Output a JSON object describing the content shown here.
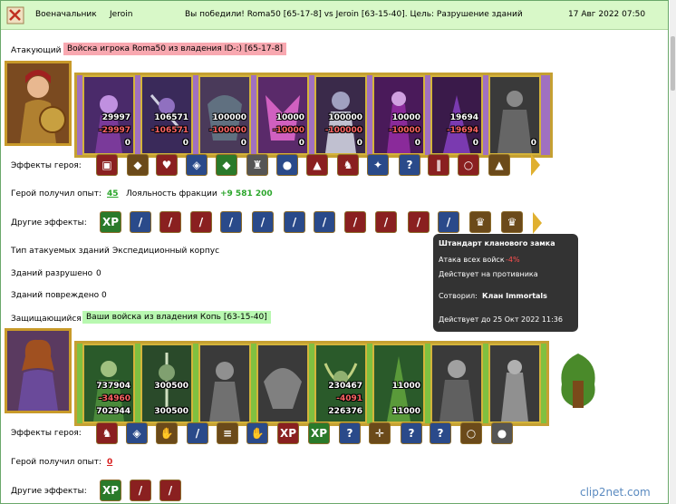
{
  "header": {
    "rank": "Военачальник",
    "player": "Jeroin",
    "result": "Вы победили! Roma50 [65-17-8] vs Jeroin [63-15-40]. Цель: Разрушение зданий",
    "datetime": "17 Авг 2022 07:50"
  },
  "attacker": {
    "label": "Атакующий",
    "name": "Войска игрока Roma50 из владения ID-:) [65-17-8]",
    "units": [
      {
        "top": "29997",
        "loss": "-29997",
        "bottom": "0"
      },
      {
        "top": "106571",
        "loss": "-106571",
        "bottom": "0"
      },
      {
        "top": "100000",
        "loss": "-100000",
        "bottom": "0"
      },
      {
        "top": "10000",
        "loss": "-10000",
        "bottom": "0"
      },
      {
        "top": "100000",
        "loss": "-100000",
        "bottom": "0"
      },
      {
        "top": "10000",
        "loss": "-10000",
        "bottom": "0"
      },
      {
        "top": "19694",
        "loss": "-19694",
        "bottom": "0"
      },
      {
        "top": "",
        "loss": "",
        "bottom": "0"
      }
    ],
    "hero_effects_label": "Эффекты героя:",
    "exp_label": "Герой получил опыт:",
    "exp_value": "45",
    "loyalty_label": "Лояльность фракции",
    "loyalty_value": "+9 581 200",
    "other_effects_label": "Другие эффекты:",
    "target_label": "Тип атакуемых зданий",
    "target_value": "Экспедиционный корпус",
    "destroyed_label": "Зданий разрушено",
    "destroyed_value": "0",
    "damaged_label": "Зданий повреждено",
    "damaged_value": "0"
  },
  "defender": {
    "label": "Защищающийся",
    "name": "Ваши войска из владения Копь [63-15-40]",
    "units": [
      {
        "top": "737904",
        "loss": "-34960",
        "bottom": "702944"
      },
      {
        "top": "300500",
        "loss": "",
        "bottom": "300500"
      },
      {
        "top": "",
        "loss": "",
        "bottom": ""
      },
      {
        "top": "",
        "loss": "",
        "bottom": ""
      },
      {
        "top": "230467",
        "loss": "-4091",
        "bottom": "226376"
      },
      {
        "top": "11000",
        "loss": "",
        "bottom": "11000"
      },
      {
        "top": "",
        "loss": "",
        "bottom": ""
      },
      {
        "top": "",
        "loss": "",
        "bottom": ""
      }
    ],
    "hero_effects_label": "Эффекты героя:",
    "exp_label": "Герой получил опыт:",
    "exp_value": "0",
    "other_effects_label": "Другие эффекты:"
  },
  "tooltip": {
    "title": "Штандарт кланового замка",
    "line1": "Атака всех войск",
    "line1_value": "-4%",
    "line2": "Действует на противника",
    "line3": "Сотворил:",
    "line3_value": "Клан Immortals",
    "line4": "Действует до 25 Окт 2022 11:36"
  },
  "watermark": "clip2net.com",
  "colors": {
    "header_bg": "#d8f8c8",
    "attacker_bg": "#f8a8b0",
    "defender_bg": "#b8f8b0",
    "gold": "#c5a032",
    "attacker_row": "#a070c0",
    "defender_row": "#80c040"
  }
}
